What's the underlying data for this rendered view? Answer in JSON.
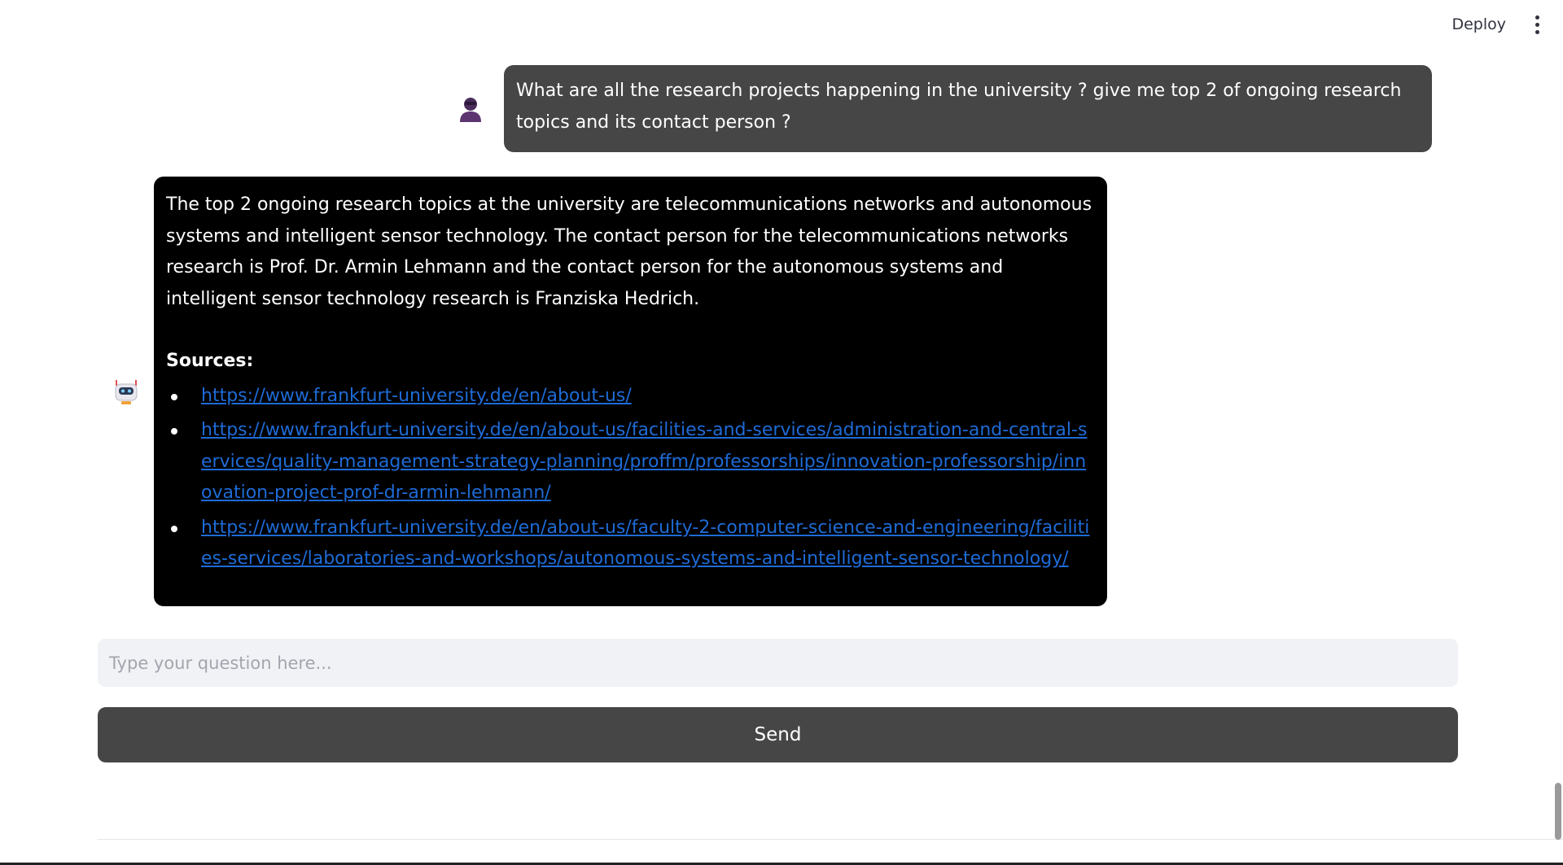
{
  "header": {
    "deploy_label": "Deploy",
    "menu_icon": "kebab-menu-icon"
  },
  "chat": {
    "user_message": {
      "avatar_icon": "user-avatar-icon",
      "text": "What are all the research projects happening in the university ? give me top 2 of ongoing research topics and its contact person ?"
    },
    "assistant_message": {
      "avatar_icon": "robot-avatar-icon",
      "text": "The top 2 ongoing research topics at the university are telecommunications networks and autonomous systems and intelligent sensor technology. The contact person for the telecommunications networks research is Prof. Dr. Armin Lehmann and the contact person for the autonomous systems and intelligent sensor technology research is Franziska Hedrich.",
      "sources_heading": "Sources:",
      "sources": [
        "https://www.frankfurt-university.de/en/about-us/",
        "https://www.frankfurt-university.de/en/about-us/facilities-and-services/administration-and-central-services/quality-management-strategy-planning/proffm/professorships/innovation-professorship/innovation-project-prof-dr-armin-lehmann/",
        "https://www.frankfurt-university.de/en/about-us/faculty-2-computer-science-and-engineering/facilities-services/laboratories-and-workshops/autonomous-systems-and-intelligent-sensor-technology/"
      ]
    }
  },
  "input": {
    "placeholder": "Type your question here...",
    "value": ""
  },
  "send_button": {
    "label": "Send"
  },
  "colors": {
    "user_bubble": "#464646",
    "assistant_bubble": "#000000",
    "link": "#1e6bd6",
    "input_bg": "#f0f2f6",
    "button_bg": "#464646"
  }
}
